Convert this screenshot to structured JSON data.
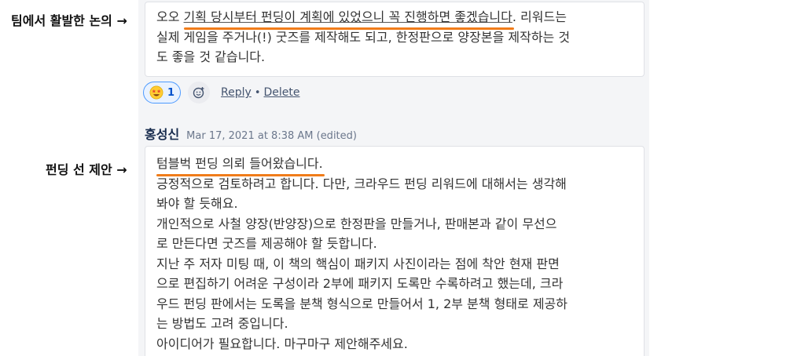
{
  "annotations": {
    "first": "팀에서 활발한 논의 →",
    "second": "펀딩 선 제안 →"
  },
  "comment1": {
    "line1_prefix": "오오 ",
    "line1_highlight": "기획 당시부터 펀딩이 계획에 있었으니 꼭 진행하면 좋겠습니다",
    "line1_suffix": ". 리워드는",
    "line2": "실제 게임을 주거나(!) 굿즈를 제작해도 되고, 한정판으로 양장본을 제작하는 것",
    "line3": "도 좋을 것 같습니다.",
    "reaction": {
      "emoji": "star-struck-emoji",
      "count": "1"
    },
    "actions": {
      "reply": "Reply",
      "separator": "•",
      "delete": "Delete"
    }
  },
  "comment2": {
    "author": "홍성신",
    "timestamp": "Mar 17, 2021 at 8:38 AM (edited)",
    "lines": [
      "텀블벅 펀딩 의뢰 들어왔습니다.",
      "긍정적으로 검토하려고 합니다. 다만, 크라우드 펀딩 리워드에 대해서는 생각해",
      "봐야 할 듯해요.",
      "개인적으로 사철 양장(반양장)으로 한정판을 만들거나, 판매본과 같이 무선으",
      "로 만든다면 굿즈를 제공해야 할 듯합니다.",
      "지난 주 저자 미팅 때, 이 책의 핵심이 패키지 사진이라는 점에 착안 현재 판면",
      "으로 편집하기 어려운 구성이라 2부에 패키지 도록만 수록하려고 했는데, 크라",
      "우드 펀딩 판에서는 도록을 분책 형식으로 만들어서 1, 2부 분책 형태로 제공하",
      "는 방법도 고려 중입니다.",
      "아이디어가 필요합니다. 마구마구 제안해주세요."
    ]
  },
  "colors": {
    "highlight_underline": "#f07c1a",
    "reaction_border": "#4c9aff",
    "reaction_bg": "#e9f2ff",
    "thread_bg": "#f4f5f7"
  }
}
